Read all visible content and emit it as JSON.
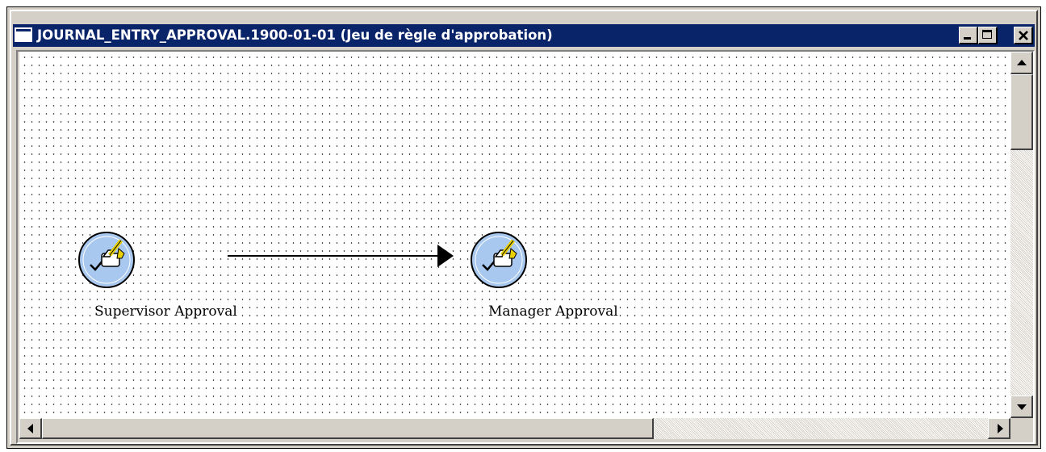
{
  "window": {
    "title": "JOURNAL_ENTRY_APPROVAL.1900-01-01 (Jeu de règle d'approbation)",
    "buttons": {
      "minimize": "minimize-icon",
      "maximize": "maximize-icon",
      "close": "close-icon"
    }
  },
  "diagram": {
    "steps": [
      {
        "label": "Supervisor Approval",
        "icon": "approval-step-icon"
      },
      {
        "label": "Manager Approval",
        "icon": "approval-step-icon"
      }
    ],
    "connector": {
      "from": "Supervisor Approval",
      "to": "Manager Approval",
      "icon": "arrow-right-icon"
    }
  },
  "colors": {
    "titlebar": "#0a246a",
    "chrome": "#d4d0c8",
    "step_fill": "#a8c8f0"
  }
}
